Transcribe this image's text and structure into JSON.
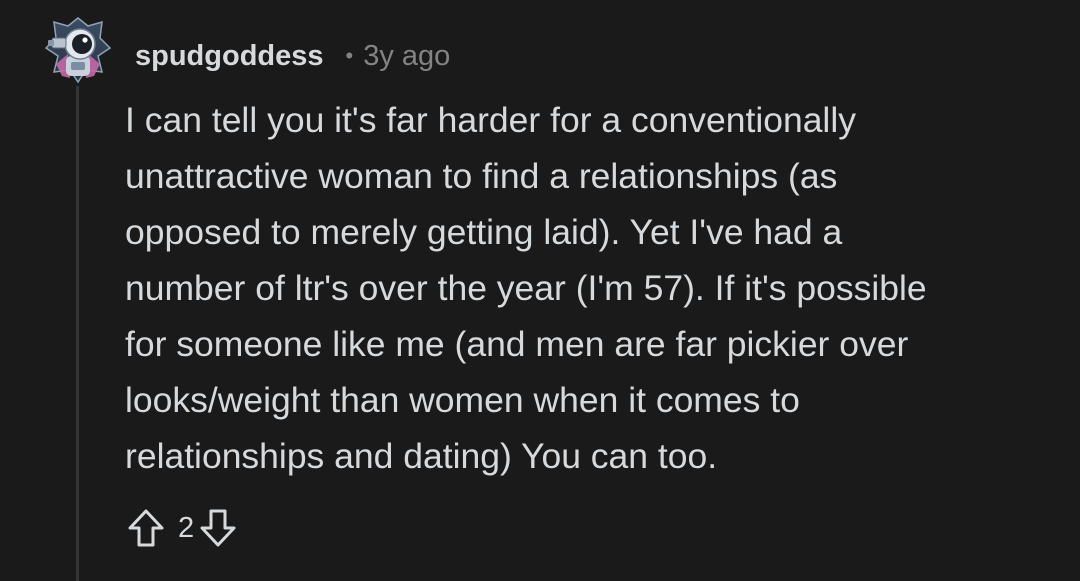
{
  "comment": {
    "author": "spudgoddess",
    "separator": "•",
    "time_ago": "3y ago",
    "body_lines": [
      "I can tell you it's far harder for a conventionally",
      "unattractive woman to find a relationships (as",
      "opposed to merely getting laid). Yet I've had a",
      "number of ltr's over the year (I'm 57). If it's possible",
      "for someone like me (and men are far pickier over",
      "looks/weight than women when it comes to",
      "relationships and dating) You can too."
    ],
    "score": "2",
    "avatar_icon": "astronaut-avatar-icon",
    "upvote_icon": "arrow-up-icon",
    "downvote_icon": "arrow-down-icon"
  },
  "colors": {
    "background": "#1a1a1b",
    "text": "#d7dadc",
    "meta": "#818384",
    "thread_line": "#343536"
  }
}
